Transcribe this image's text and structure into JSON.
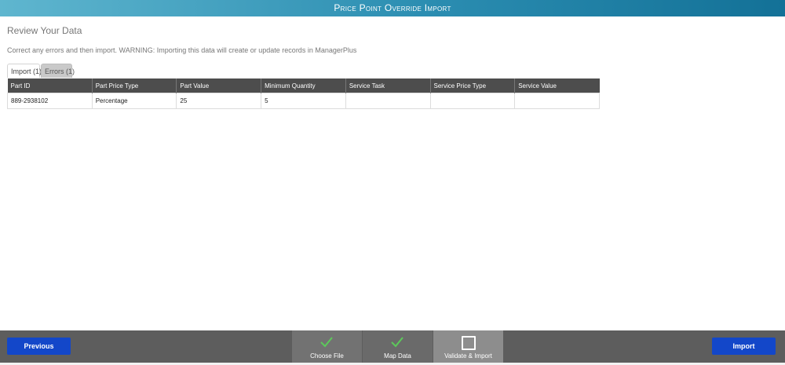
{
  "window": {
    "title": "Price Point Override Import"
  },
  "review": {
    "title": "Review Your Data",
    "warning": "Correct any errors and then import. WARNING: Importing this data will create or update records in ManagerPlus"
  },
  "tabs": [
    {
      "label": "Import (1)",
      "active": true
    },
    {
      "label": "Errors (1)",
      "active": false
    }
  ],
  "table": {
    "columns": [
      "Part ID",
      "Part Price Type",
      "Part Value",
      "Minimum Quantity",
      "Service Task",
      "Service Price Type",
      "Service Value"
    ],
    "rows": [
      [
        "889-2938102",
        "Percentage",
        "25",
        "5",
        "",
        "",
        ""
      ]
    ]
  },
  "footer": {
    "previous_label": "Previous",
    "import_label": "Import",
    "steps": [
      {
        "label": "Choose File",
        "state": "complete",
        "icon": "check-icon"
      },
      {
        "label": "Map Data",
        "state": "complete",
        "icon": "check-icon"
      },
      {
        "label": "Validate & Import",
        "state": "current",
        "icon": "checkbox-icon"
      }
    ]
  },
  "colors": {
    "title_gradient_start": "#5fb6cf",
    "title_gradient_end": "#137197",
    "header_bg": "#4d4d4d",
    "button_blue": "#1347c9",
    "footer_bg": "#5d5d5d",
    "check_green": "#5cc85a"
  }
}
